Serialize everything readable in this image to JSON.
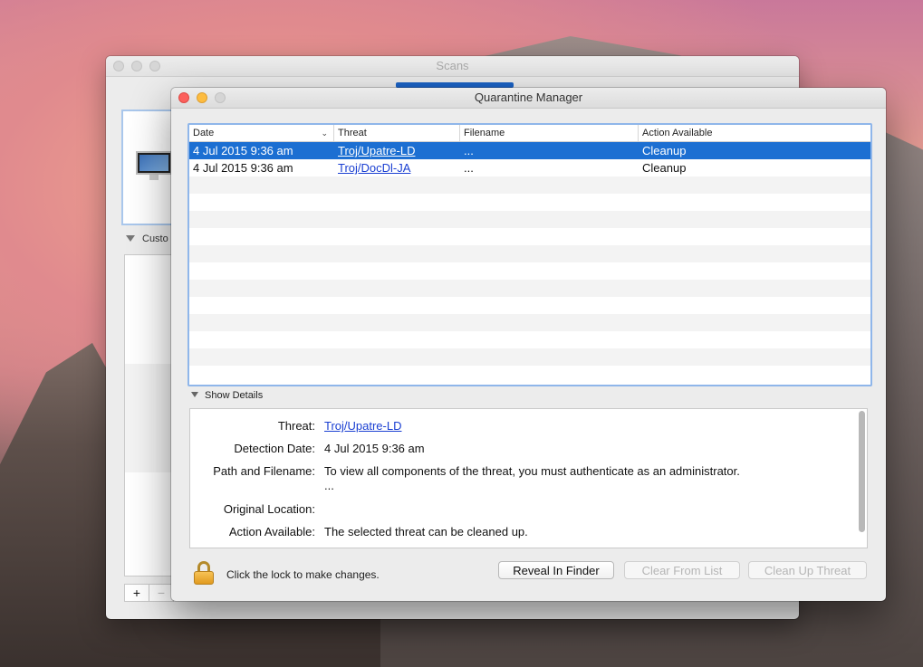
{
  "background_window": {
    "title": "Scans",
    "custom_label": "Custo",
    "add_button": "+",
    "remove_button": "−"
  },
  "window": {
    "title": "Quarantine Manager"
  },
  "table": {
    "columns": [
      "Date",
      "Threat",
      "Filename",
      "Action Available"
    ],
    "rows": [
      {
        "date": "4 Jul 2015 9:36 am",
        "threat": "Troj/Upatre-LD",
        "filename": "...",
        "action": "Cleanup",
        "selected": true
      },
      {
        "date": "4 Jul 2015 9:36 am",
        "threat": "Troj/DocDl-JA",
        "filename": "...",
        "action": "Cleanup",
        "selected": false
      }
    ]
  },
  "details": {
    "toggle_label": "Show Details",
    "threat_label": "Threat:",
    "threat_value": "Troj/Upatre-LD",
    "detection_label": "Detection Date:",
    "detection_value": "4 Jul 2015 9:36 am",
    "path_label": "Path and Filename:",
    "path_value": "To view all components of the threat, you must authenticate as an administrator.",
    "path_value2": "...",
    "original_label": "Original Location:",
    "original_value": "",
    "action_label": "Action Available:",
    "action_value": "The selected threat can be cleaned up."
  },
  "footer": {
    "lock_text": "Click the lock to make changes.",
    "reveal_button": "Reveal In Finder",
    "clear_button": "Clear From List",
    "cleanup_button": "Clean Up Threat"
  },
  "colors": {
    "selection": "#1c6fd2",
    "link": "#1a3fd2",
    "focus_ring": "#8fb6ea"
  }
}
